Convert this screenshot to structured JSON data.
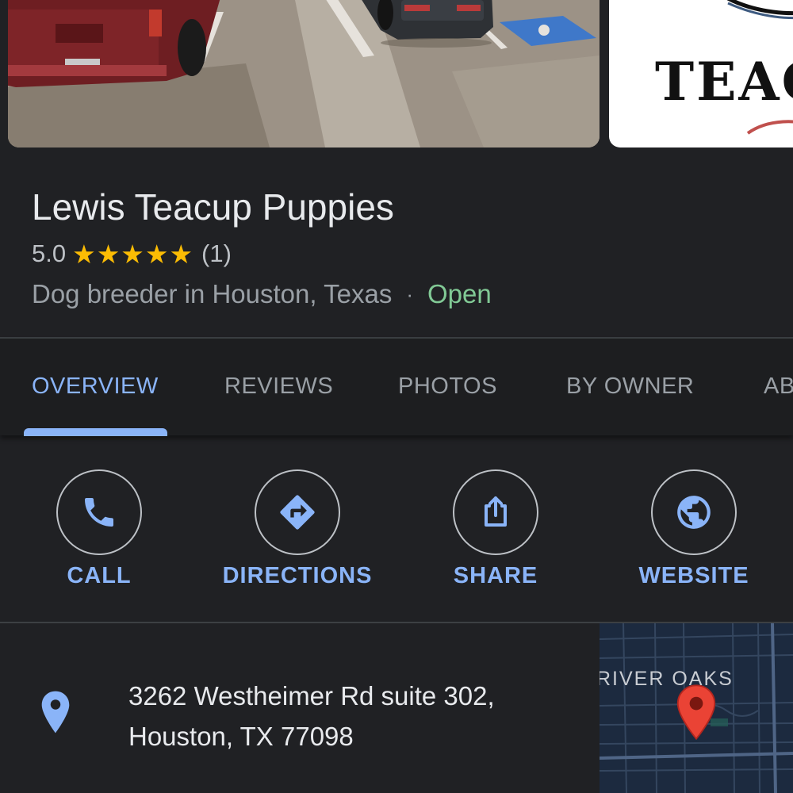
{
  "photos": {
    "logo_text": "TEAC"
  },
  "place": {
    "name": "Lewis Teacup Puppies",
    "rating": "5.0",
    "stars": "★★★★★",
    "review_count": "(1)",
    "category": "Dog breeder in Houston, Texas",
    "separator": "·",
    "status": "Open",
    "status_color": "#81c995"
  },
  "tabs": [
    {
      "label": "OVERVIEW",
      "active": true
    },
    {
      "label": "REVIEWS"
    },
    {
      "label": "PHOTOS"
    },
    {
      "label": "BY OWNER"
    },
    {
      "label": "AB"
    }
  ],
  "actions": [
    {
      "label": "CALL",
      "icon": "phone-icon"
    },
    {
      "label": "DIRECTIONS",
      "icon": "directions-icon"
    },
    {
      "label": "SHARE",
      "icon": "share-icon"
    },
    {
      "label": "WEBSITE",
      "icon": "globe-icon"
    }
  ],
  "address": {
    "line1": "3262 Westheimer Rd suite 302,",
    "line2": "Houston, TX 77098",
    "icon": "location-pin-icon"
  },
  "map": {
    "area_label": "RIVER OAKS",
    "pin_color": "#ea4335"
  },
  "colors": {
    "background": "#202124",
    "accent": "#8ab4f8",
    "star": "#fbbc04"
  }
}
